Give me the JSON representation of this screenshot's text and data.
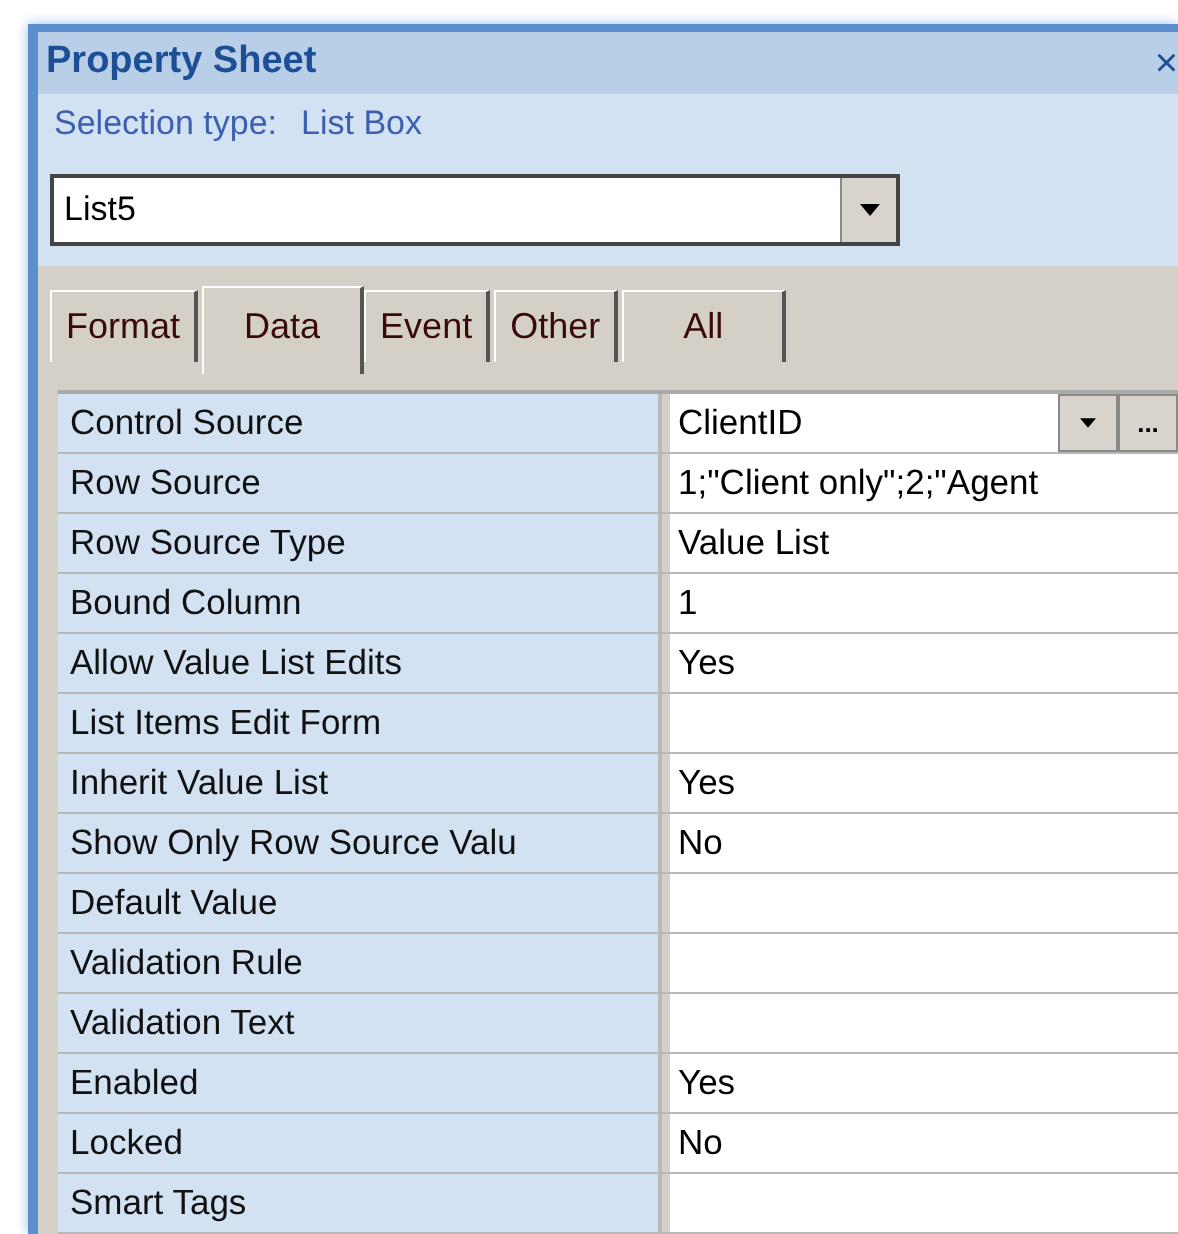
{
  "panel": {
    "title": "Property Sheet",
    "close": "×",
    "selection_label": "Selection type:",
    "selection_value": "List Box"
  },
  "object_combo": {
    "value": "List5"
  },
  "tabs": [
    {
      "label": "Format",
      "selected": false
    },
    {
      "label": "Data",
      "selected": true
    },
    {
      "label": "Event",
      "selected": false
    },
    {
      "label": "Other",
      "selected": false
    },
    {
      "label": "All",
      "selected": false
    }
  ],
  "properties": [
    {
      "name": "Control Source",
      "value": "ClientID",
      "kind": "combo",
      "builder": "..."
    },
    {
      "name": "Row Source",
      "value": "1;\"Client only\";2;\"Agent",
      "kind": "text"
    },
    {
      "name": "Row Source Type",
      "value": "Value List",
      "kind": "text"
    },
    {
      "name": "Bound Column",
      "value": "1",
      "kind": "text"
    },
    {
      "name": "Allow Value List Edits",
      "value": "Yes",
      "kind": "text"
    },
    {
      "name": "List Items Edit Form",
      "kind": "text"
    },
    {
      "name": "Inherit Value List",
      "value": "Yes",
      "kind": "text"
    },
    {
      "name": "Show Only Row Source Valu",
      "value": "No",
      "kind": "text"
    },
    {
      "name": "Default Value",
      "kind": "text"
    },
    {
      "name": "Validation Rule",
      "kind": "text"
    },
    {
      "name": "Validation Text",
      "kind": "text"
    },
    {
      "name": "Enabled",
      "value": "Yes",
      "kind": "text"
    },
    {
      "name": "Locked",
      "value": "No",
      "kind": "text"
    },
    {
      "name": "Smart Tags",
      "kind": "text"
    }
  ]
}
